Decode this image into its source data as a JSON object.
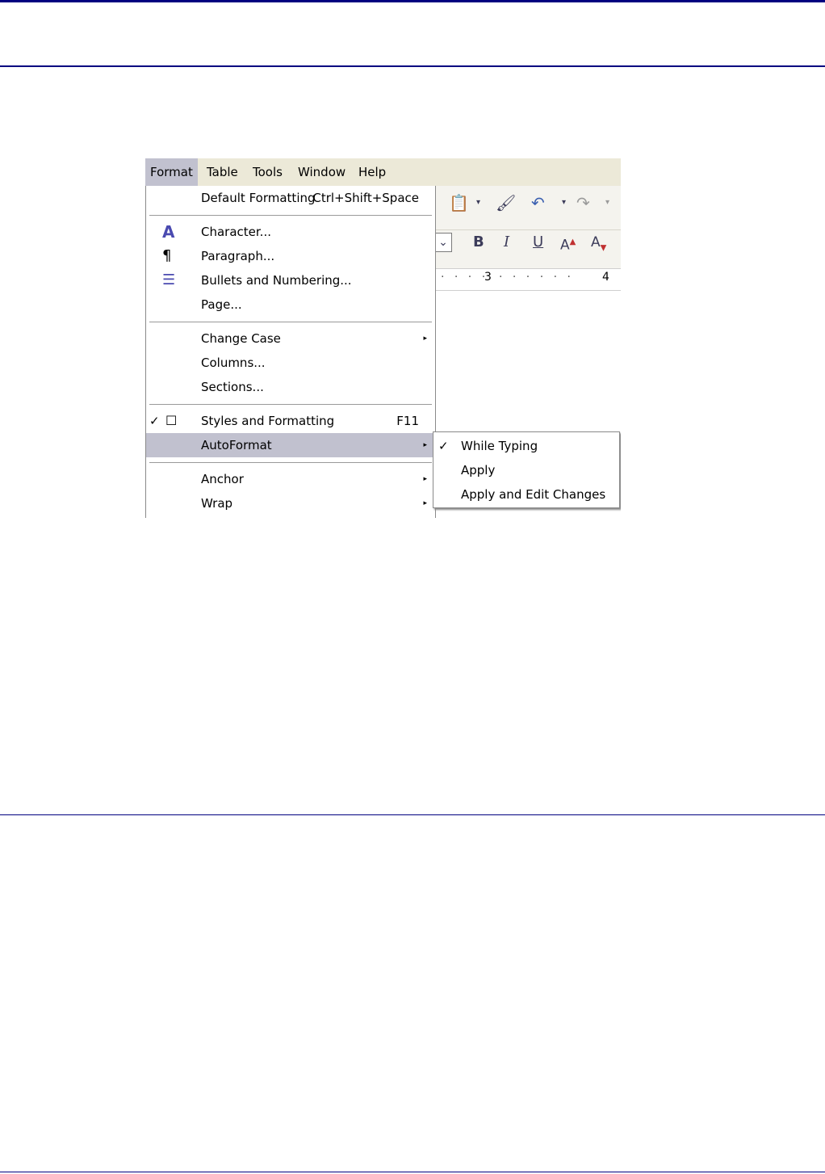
{
  "menubar": {
    "items": [
      "Format",
      "Table",
      "Tools",
      "Window",
      "Help"
    ]
  },
  "format_menu": {
    "default_formatting": {
      "label": "Default Formatting",
      "shortcut": "Ctrl+Shift+Space"
    },
    "character": "Character...",
    "paragraph": "Paragraph...",
    "bullets": "Bullets and Numbering...",
    "page": "Page...",
    "change_case": "Change Case",
    "columns": "Columns...",
    "sections": "Sections...",
    "styles": {
      "label": "Styles and Formatting",
      "shortcut": "F11"
    },
    "autoformat": "AutoFormat",
    "anchor": "Anchor",
    "wrap": "Wrap"
  },
  "autoformat_submenu": {
    "while_typing": "While Typing",
    "apply": "Apply",
    "apply_edit": "Apply and Edit Changes"
  },
  "toolbar": {
    "bold": "B",
    "italic": "I",
    "underline": "U"
  },
  "ruler": {
    "mark3": "3",
    "mark4": "4"
  },
  "icons": {
    "check": "✓",
    "submenu_arrow": "▸"
  }
}
